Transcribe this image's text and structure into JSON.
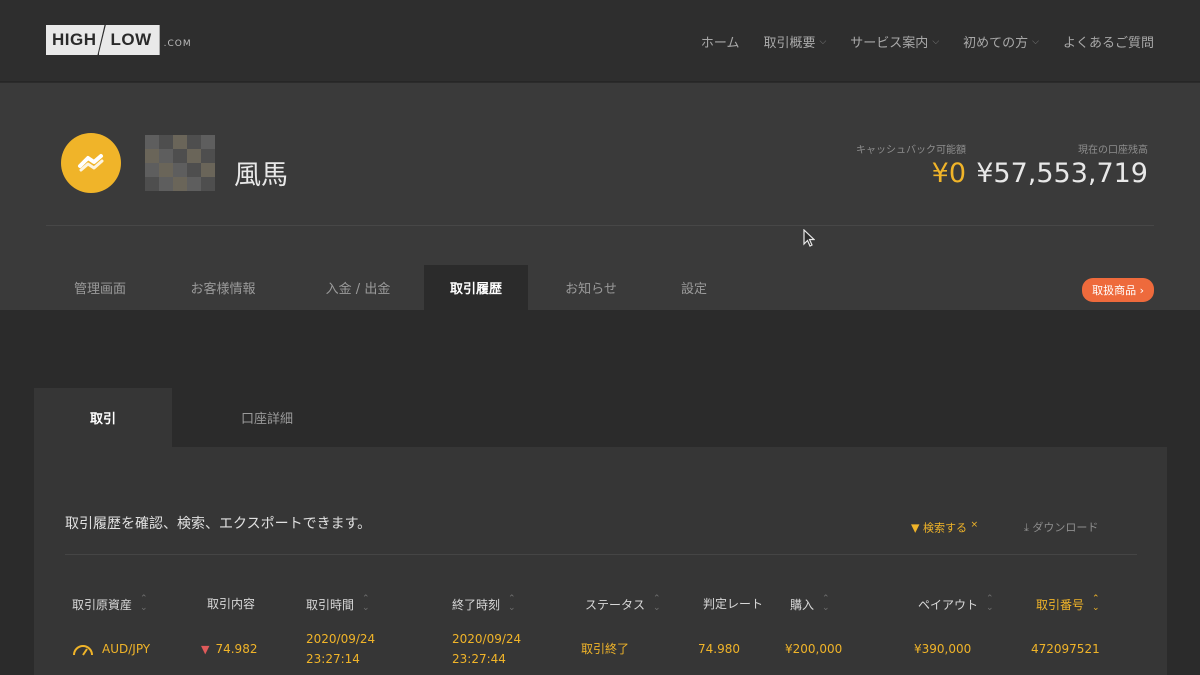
{
  "logo": {
    "high": "HIGH",
    "low": "LOW",
    "com": ".COM"
  },
  "nav": {
    "items": [
      {
        "label": "ホーム",
        "dropdown": false
      },
      {
        "label": "取引概要",
        "dropdown": true
      },
      {
        "label": "サービス案内",
        "dropdown": true
      },
      {
        "label": "初めての方",
        "dropdown": true
      },
      {
        "label": "よくあるご質問",
        "dropdown": false
      }
    ]
  },
  "account": {
    "username": "風馬",
    "cashback_label": "キャッシュバック可能額",
    "cashback_value": "¥0",
    "balance_label": "現在の口座残高",
    "balance_value": "¥57,553,719"
  },
  "tabs": {
    "items": [
      {
        "label": "管理画面",
        "active": false
      },
      {
        "label": "お客様情報",
        "active": false
      },
      {
        "label": "入金 / 出金",
        "active": false
      },
      {
        "label": "取引履歴",
        "active": true
      },
      {
        "label": "お知らせ",
        "active": false
      },
      {
        "label": "設定",
        "active": false
      }
    ],
    "products_button": "取扱商品 ›"
  },
  "panel": {
    "tabs": [
      {
        "label": "取引",
        "active": true
      },
      {
        "label": "口座詳細",
        "active": false
      }
    ],
    "description": "取引履歴を確認、検索、エクスポートできます。",
    "search_label": "検索する",
    "download_label": "ダウンロード"
  },
  "table": {
    "headers": [
      {
        "label": "取引原資産",
        "sorted": false
      },
      {
        "label": "取引内容",
        "sorted": false
      },
      {
        "label": "取引時間",
        "sorted": false
      },
      {
        "label": "終了時刻",
        "sorted": false
      },
      {
        "label": "ステータス",
        "sorted": false
      },
      {
        "label": "判定レート",
        "sorted": false
      },
      {
        "label": "購入",
        "sorted": false
      },
      {
        "label": "ペイアウト",
        "sorted": false
      },
      {
        "label": "取引番号",
        "sorted": true
      }
    ],
    "rows": [
      {
        "asset": "AUD/JPY",
        "content": "74.982",
        "trade_date": "2020/09/24",
        "trade_time": "23:27:14",
        "end_date": "2020/09/24",
        "end_time": "23:27:44",
        "status": "取引終了",
        "rate": "74.980",
        "purchase": "¥200,000",
        "payout": "¥390,000",
        "trade_no": "472097521"
      }
    ]
  },
  "colors": {
    "accent": "#f0b429",
    "orange": "#ee6a3c",
    "background": "#2b2b2b",
    "panel": "#363636",
    "header": "#3a3a3a",
    "down": "#e05a5a"
  }
}
